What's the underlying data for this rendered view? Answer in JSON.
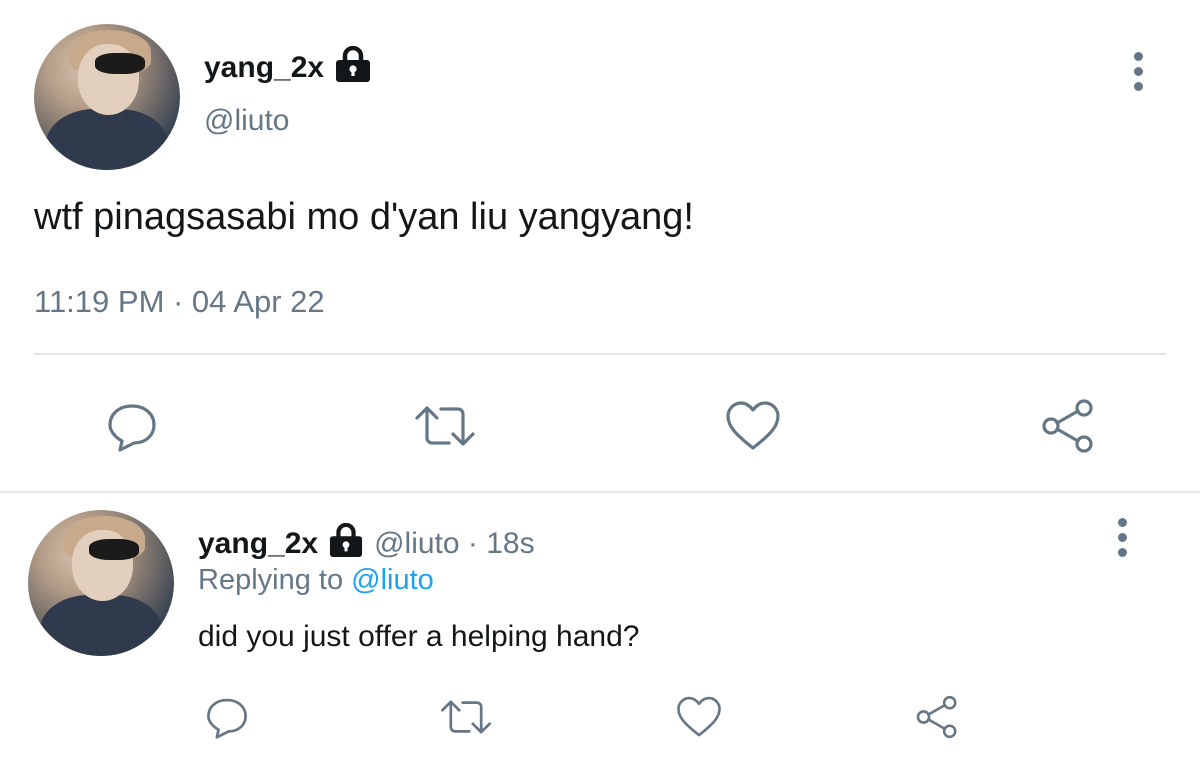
{
  "main_tweet": {
    "display_name": "yang_2x",
    "handle": "@liuto",
    "text": "wtf pinagsasabi mo d'yan liu yangyang!",
    "timestamp": "11:19 PM · 04 Apr 22",
    "icons": {
      "lock": "lock-icon",
      "more": "more-vertical-icon",
      "reply": "reply-icon",
      "retweet": "retweet-icon",
      "like": "heart-icon",
      "share": "share-icon"
    }
  },
  "reply_tweet": {
    "display_name": "yang_2x",
    "handle_time": "@liuto · 18s",
    "replying_prefix": "Replying to",
    "replying_handle": "@liuto",
    "text": "did you just offer a helping hand?"
  },
  "colors": {
    "text": "#14171a",
    "secondary": "#657786",
    "link": "#1da1f2",
    "divider": "#e1e8ed"
  }
}
